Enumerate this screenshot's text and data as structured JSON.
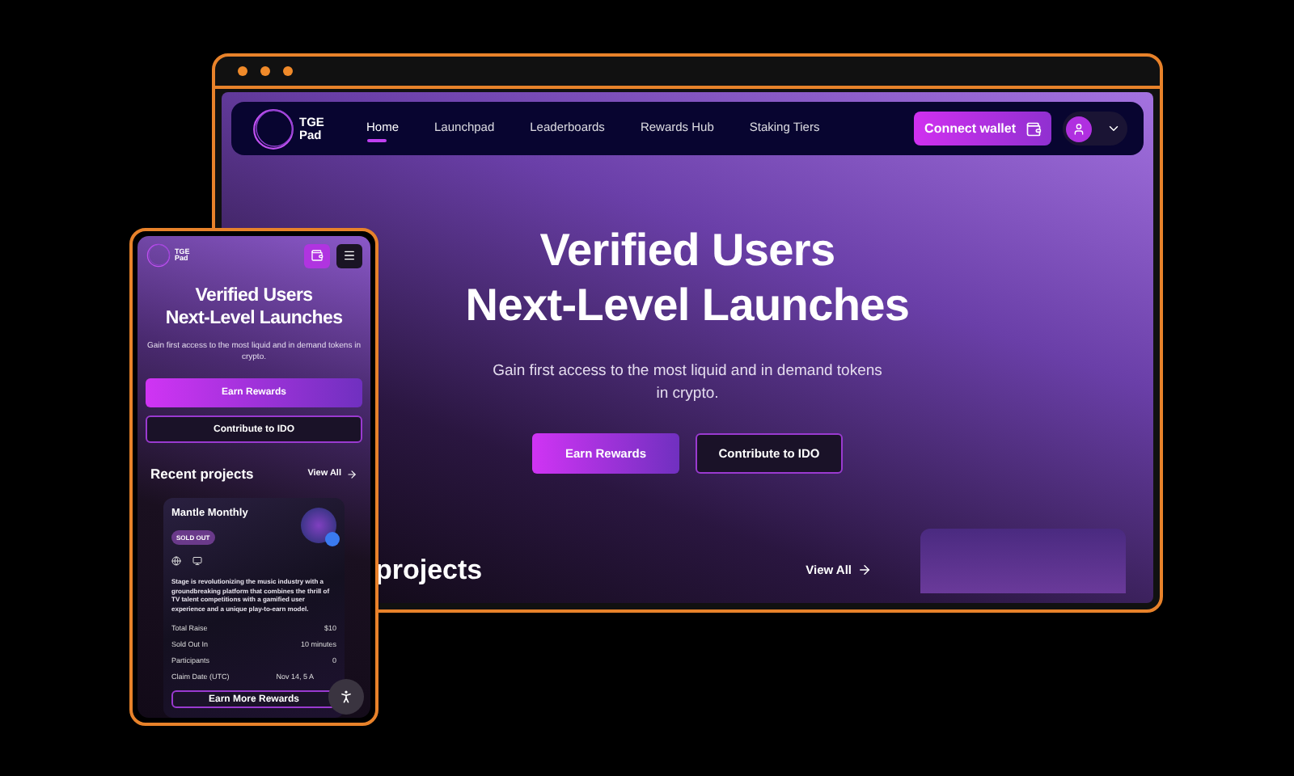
{
  "desktop": {
    "logo": "TGE Pad",
    "nav": [
      {
        "label": "Home",
        "selected": true
      },
      {
        "label": "Launchpad",
        "selected": false
      },
      {
        "label": "Leaderboards",
        "selected": false
      },
      {
        "label": "Rewards Hub",
        "selected": false
      },
      {
        "label": "Staking Tiers",
        "selected": false
      }
    ],
    "connect_button": "Connect wallet",
    "hero": {
      "title": [
        "Verified Users",
        "Next-Level Launches"
      ],
      "subtitle": "Gain first access to the most liquid and in demand tokens in crypto.",
      "primary_button": "Earn Rewards",
      "secondary_button": "Contribute to IDO"
    },
    "section_title": "projects",
    "view_all": "View All"
  },
  "mobile": {
    "logo": "TGE Pad",
    "hero": {
      "title": [
        "Verified Users",
        "Next-Level Launches"
      ],
      "subtitle": "Gain first access to the most liquid and in demand tokens in crypto.",
      "primary_button": "Earn Rewards",
      "secondary_button": "Contribute to IDO"
    },
    "section_title": "Recent projects",
    "view_all": "View All",
    "card": {
      "title": "Mantle Monthly",
      "badge": "SOLD OUT",
      "description": "Stage is revolutionizing the music industry with a groundbreaking platform that combines the thrill of TV talent competitions with a gamified user experience and a unique play-to-earn model.",
      "stats": [
        {
          "label": "Total Raise",
          "value": "$10"
        },
        {
          "label": "Sold Out In",
          "value": "10 minutes"
        },
        {
          "label": "Participants",
          "value": "0"
        },
        {
          "label": "Claim Date (UTC)",
          "value": "Nov 14, 5 A"
        }
      ],
      "button": "Earn More Rewards"
    }
  }
}
